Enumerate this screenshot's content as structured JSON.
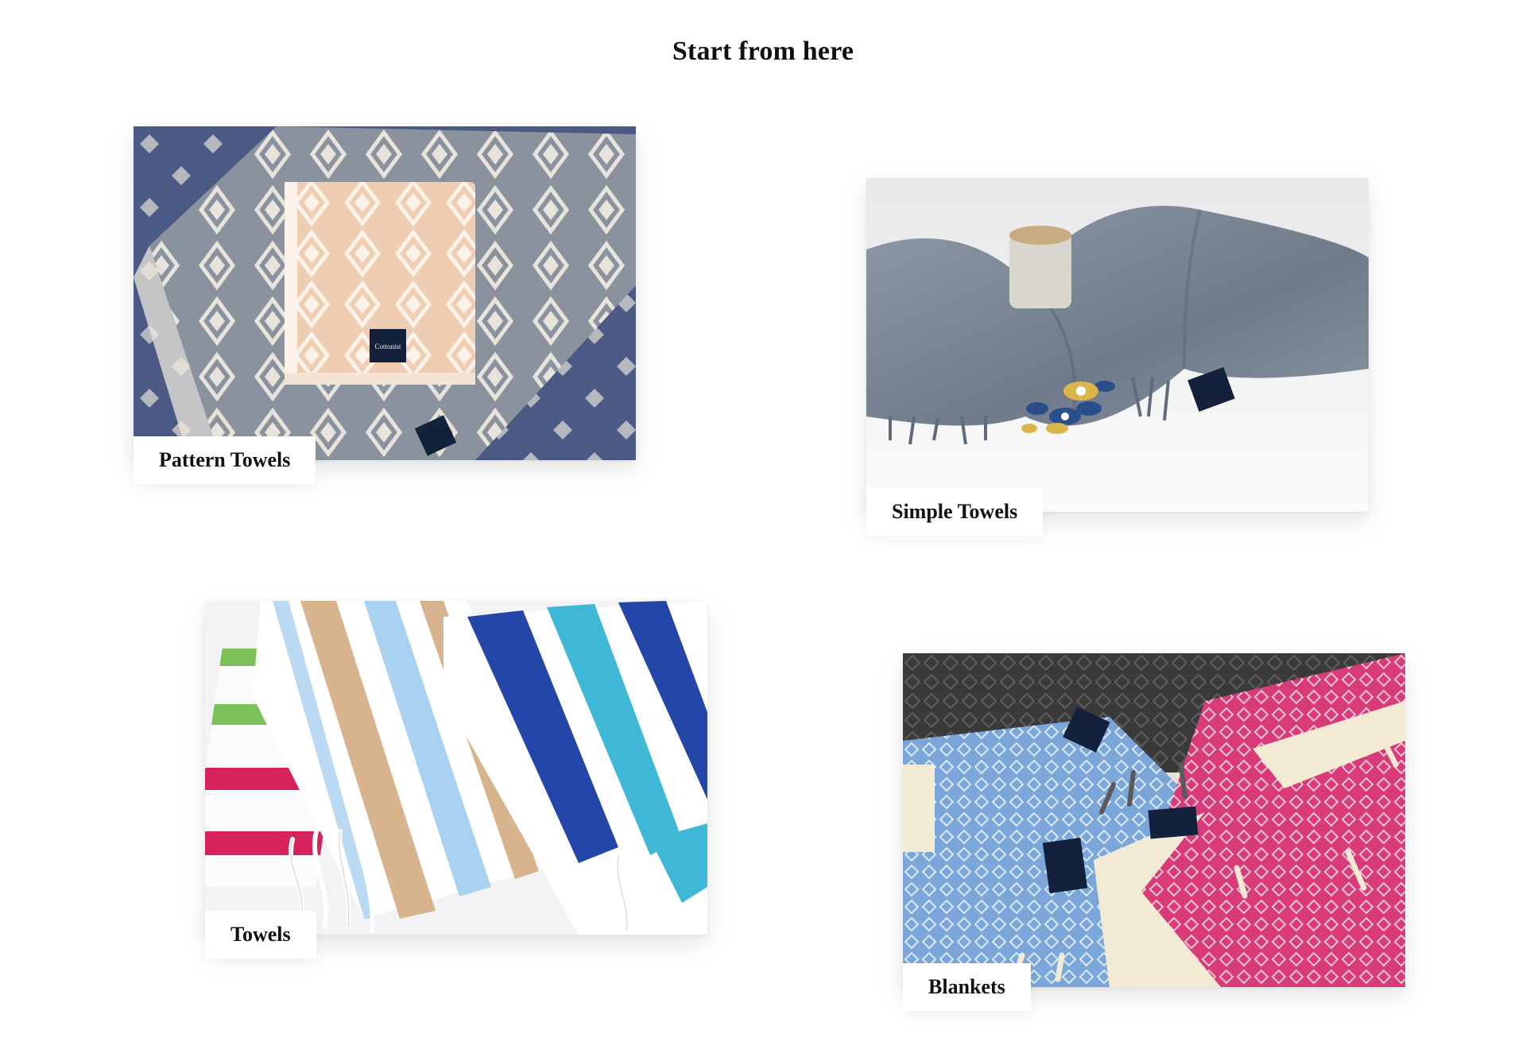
{
  "section": {
    "title": "Start from here"
  },
  "categories": [
    {
      "label": "Pattern Towels",
      "image": "pattern-towels-photo"
    },
    {
      "label": "Simple Towels",
      "image": "simple-towels-photo"
    },
    {
      "label": "Towels",
      "image": "striped-towels-photo"
    },
    {
      "label": "Blankets",
      "image": "blankets-photo"
    }
  ],
  "colors": {
    "text": "#111111",
    "background": "#ffffff",
    "denim_blue": "#4a5a85",
    "grey_towel": "#8a929e",
    "peach_towel": "#efcdb2",
    "slate_towel": "#7b8794",
    "navy_tag": "#14213d",
    "stripe_blue": "#2446a8",
    "stripe_aqua": "#3fb7d6",
    "stripe_tan": "#d8b48e",
    "stripe_pink": "#d6245a",
    "stripe_green": "#7cc15a",
    "blanket_charcoal": "#3a3a3a",
    "blanket_pink": "#d83b77",
    "blanket_cream": "#f3ead3",
    "blanket_sky": "#7aa6da"
  }
}
